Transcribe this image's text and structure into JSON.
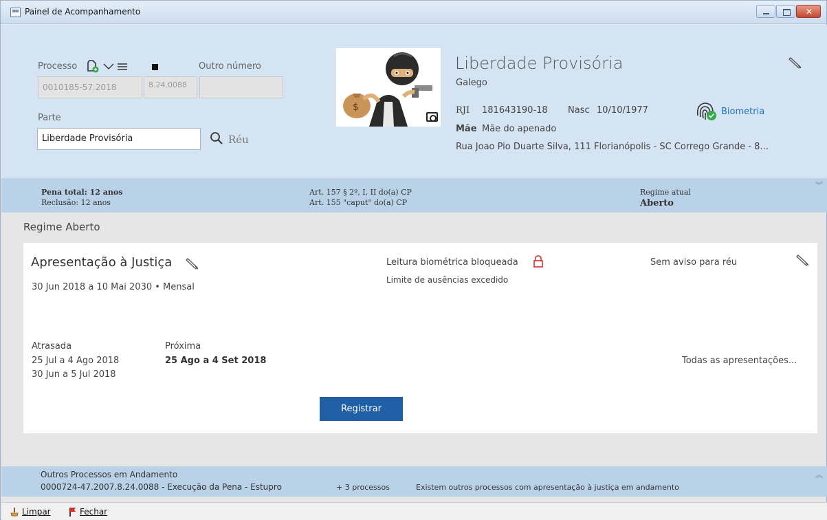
{
  "window": {
    "title": "Painel de Acompanhamento"
  },
  "header": {
    "processo_label": "Processo",
    "outro_numero_label": "Outro número",
    "processo_value": "0010185-57.2018",
    "processo_suffix": "8.24.0088",
    "outro_numero_value": "",
    "parte_label": "Parte",
    "parte_value": "Liberdade Provisória",
    "reu_label": "Réu"
  },
  "person": {
    "name": "Liberdade Provisória",
    "alias": "Galego",
    "rji_label": "RJI",
    "rji_value": "181643190-18",
    "nasc_label": "Nasc",
    "nasc_value": "10/10/1977",
    "biometria": "Biometria",
    "mae_label": "Mãe",
    "mae_value": "Mãe do apenado",
    "address": "Rua Joao Pio Duarte Silva, 111 Florianópolis - SC Corrego Grande - 8..."
  },
  "summary": {
    "pena_total": "Pena total: 12 anos",
    "reclusao": "Reclusão: 12 anos",
    "art1": "Art. 157 § 2º, I, II do(a) CP",
    "art2": "Art. 155 \"caput\" do(a) CP",
    "regime_label": "Regime atual",
    "regime_value": "Aberto"
  },
  "section_title": "Regime Aberto",
  "card": {
    "title": "Apresentação à Justiça",
    "period": "30 Jun 2018 a 10 Mai 2030 • Mensal",
    "leitura": "Leitura biométrica bloqueada",
    "limite": "Limite de ausências excedido",
    "aviso": "Sem aviso para réu",
    "atrasada_label": "Atrasada",
    "atrasada_1": "25 Jul a 4 Ago 2018",
    "atrasada_2": "30 Jun a 5 Jul 2018",
    "proxima_label": "Próxima",
    "proxima_value": "25 Ago a 4 Set 2018",
    "todas_link": "Todas as apresentações...",
    "registrar": "Registrar"
  },
  "footer": {
    "outros_label": "Outros Processos em Andamento",
    "outro_processo": "0000724-47.2007.8.24.0088 - Execução da Pena - Estupro",
    "mais_processos": "+ 3 processos",
    "alerta": "Existem outros processos com apresentação à justiça em andamento"
  },
  "statusbar": {
    "limpar": "Limpar",
    "fechar": "Fechar"
  },
  "colors": {
    "accent": "#1e5fa6",
    "link": "#1e73be",
    "alert": "#d0302a",
    "header_bg": "#d5e4f2",
    "band_bg": "#b9d2e7"
  }
}
